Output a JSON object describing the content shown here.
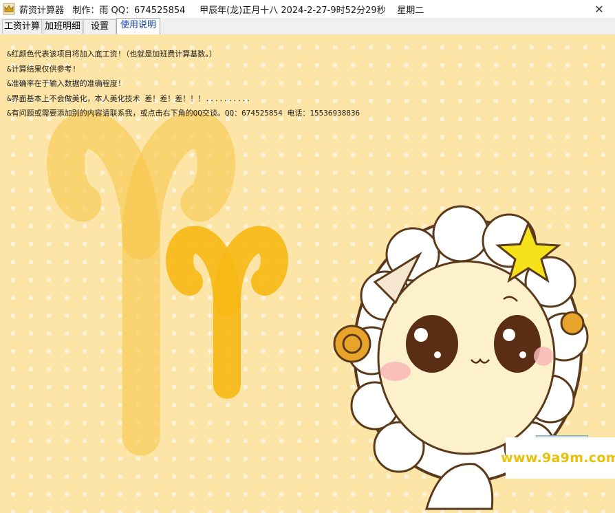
{
  "titlebar": {
    "title": "薪资计算器   制作：雨 QQ：674525854     甲辰年(龙)正月十八 2024-2-27-9时52分29秒    星期二",
    "close_glyph": "✕"
  },
  "tabs": [
    {
      "label": "工资计算",
      "active": false
    },
    {
      "label": "加班明细",
      "active": false
    },
    {
      "label": "设置",
      "active": false
    },
    {
      "label": "使用说明",
      "active": true
    }
  ],
  "instructions": [
    "&红颜色代表该项目将加入底工资!（也就是加班费计算基数。）",
    "&计算结果仅供参考!",
    "&准确率在于输入数据的准确程度!",
    "&界面基本上不会做美化，本人美化技术 差！差！差！！！..........",
    "&有问题或需要添加别的内容请联系我，或点击右下角的QQ交谈。QQ：674525854 电话：15536938836"
  ],
  "watermark": "www.9a9m.com",
  "colors": {
    "background": "#fde5a8",
    "aries_symbol": "#f7c23a",
    "active_tab_text": "#0b3bb5",
    "watermark": "#e8c20a"
  },
  "icons": [
    "crown-app-icon",
    "close-icon",
    "aries-symbol-icon",
    "star-icon",
    "sheep-mascot"
  ]
}
